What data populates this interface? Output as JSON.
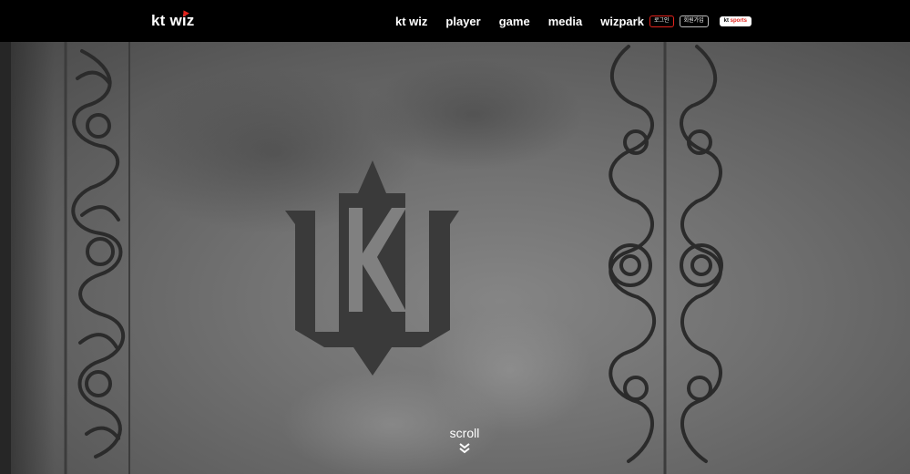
{
  "header": {
    "logo_text": "kt wiz",
    "nav": [
      "kt wiz",
      "player",
      "game",
      "media",
      "wizpark"
    ],
    "utility": {
      "login_label": "로그인",
      "join_label": "회원가입",
      "sports_kt": "kt",
      "sports_text": "sports"
    }
  },
  "hero": {
    "scroll_label": "scroll"
  },
  "colors": {
    "accent_red": "#e4231c",
    "header_bg": "#000000"
  }
}
